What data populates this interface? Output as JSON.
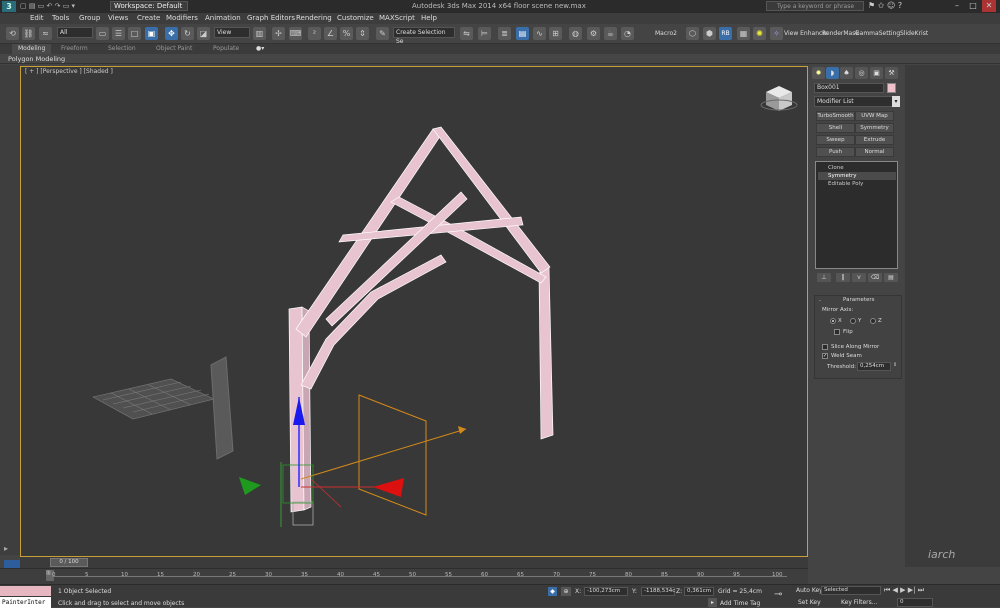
{
  "titlebar": {
    "logo": "3",
    "workspace": "Workspace: Default",
    "title": "Autodesk 3ds Max 2014 x64    floor scene new.max",
    "search_placeholder": "Type a keyword or phrase"
  },
  "menu": [
    "Edit",
    "Tools",
    "Group",
    "Views",
    "Create",
    "Modifiers",
    "Animation",
    "Graph Editors",
    "Rendering",
    "Customize",
    "MAXScript",
    "Help"
  ],
  "toolbar": {
    "filter": "All",
    "refcoord": "View",
    "selection_set": "Create Selection Se",
    "macro": "Macro2",
    "rb": "RB",
    "viewenhancer": "View Enhancer",
    "rendermask": "RenderMask",
    "gammasetting": "GammaSetting",
    "slidekrist": "SlideKrist"
  },
  "ribbon": {
    "tabs": [
      "Modeling",
      "Freeform",
      "Selection",
      "Object Paint",
      "Populate"
    ],
    "panel": "Polygon Modeling"
  },
  "viewport": {
    "label": "[ + ] [Perspective ] [Shaded ]"
  },
  "command_panel": {
    "object_name": "Box001",
    "modifier_list": "Modifier List",
    "buttons": [
      "TurboSmooth",
      "UVW Map",
      "Shell",
      "Symmetry",
      "Sweep",
      "Extrude",
      "Push",
      "Normal"
    ],
    "stack": [
      "Clone",
      "Symmetry",
      "Editable Poly"
    ],
    "params_title": "Parameters",
    "mirror_axis": "Mirror Axis:",
    "axes": [
      "X",
      "Y",
      "Z"
    ],
    "flip": "Flip",
    "slice": "Slice Along Mirror",
    "weld": "Weld Seam",
    "threshold_label": "Threshold:",
    "threshold_value": "0,254cm"
  },
  "timeline": {
    "frame": "0 / 100",
    "ticks": [
      "0",
      "5",
      "10",
      "15",
      "20",
      "25",
      "30",
      "35",
      "40",
      "45",
      "50",
      "55",
      "60",
      "65",
      "70",
      "75",
      "80",
      "85",
      "90",
      "95",
      "100"
    ]
  },
  "status": {
    "listener": "PainterInter",
    "selection": "1 Object Selected",
    "prompt": "Click and drag to select and move objects",
    "x_label": "X:",
    "x": "-100,273cm",
    "y_label": "Y:",
    "y": "-1188,534c",
    "z_label": "Z:",
    "z": "0,361cm",
    "grid": "Grid = 25,4cm",
    "add_time_tag": "Add Time Tag",
    "auto_key": "Auto Key",
    "set_key": "Set Key",
    "selected": "Selected",
    "key_filters": "Key Filters...",
    "frame_field": "0"
  },
  "watermark": "iarch"
}
